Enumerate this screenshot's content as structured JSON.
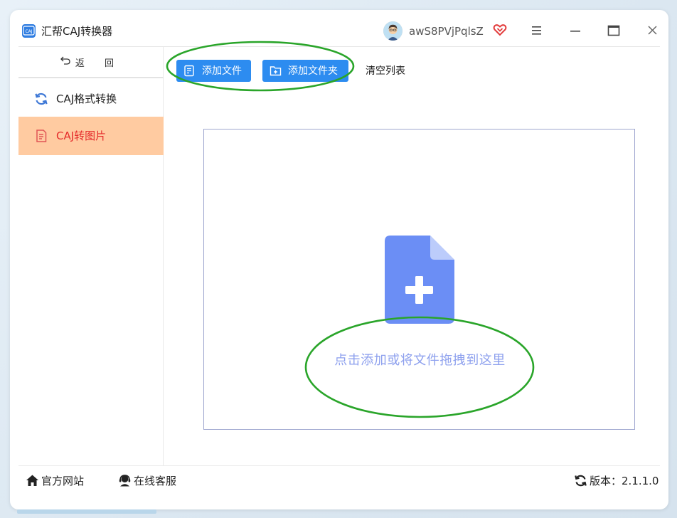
{
  "app": {
    "title": "汇帮CAJ转换器",
    "icon_text": "CAJ",
    "username": "awS8PVjPqlsZ",
    "accent_color": "#2d8cf0"
  },
  "window_controls": {
    "menu": "menu-icon",
    "minimize": "minimize-icon",
    "maximize": "maximize-icon",
    "close": "close-icon"
  },
  "sidebar": {
    "back_label": "返 回",
    "items": [
      {
        "label": "CAJ格式转换",
        "icon": "refresh-icon",
        "active": false
      },
      {
        "label": "CAJ转图片",
        "icon": "document-icon",
        "active": true,
        "active_bg": "#ffcba1",
        "active_color": "#e52b2b"
      }
    ]
  },
  "toolbar": {
    "add_file": "添加文件",
    "add_folder": "添加文件夹",
    "clear_list": "清空列表"
  },
  "dropzone": {
    "hint": "点击添加或将文件拖拽到这里",
    "icon": "file-add-icon",
    "icon_color": "#6b8ef5"
  },
  "footer": {
    "website": "官方网站",
    "service": "在线客服",
    "version": "版本：2.1.1.0"
  }
}
